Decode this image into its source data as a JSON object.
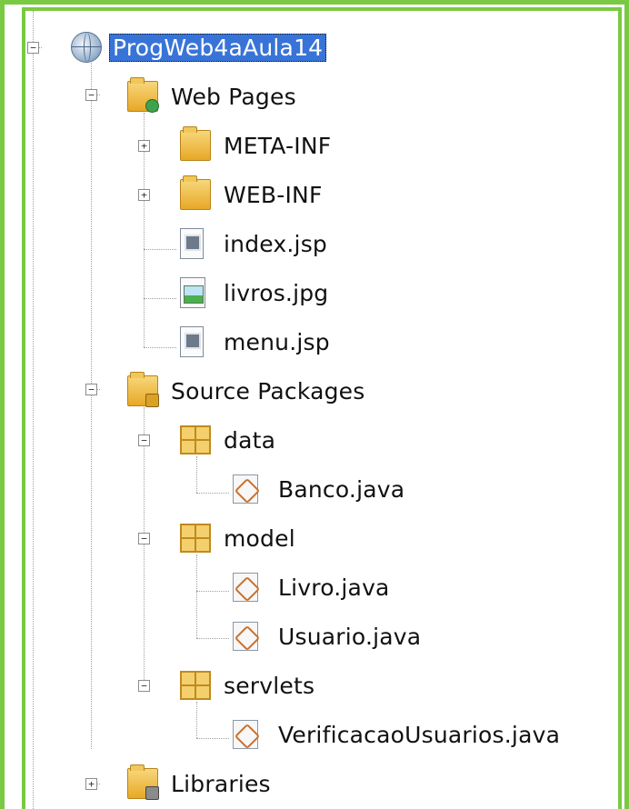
{
  "colors": {
    "frame": "#7ac943",
    "selection": "#3874d8"
  },
  "tree": {
    "project": {
      "label": "ProgWeb4aAula14",
      "icon": "globe-icon",
      "expander": "−"
    },
    "web_pages": {
      "label": "Web Pages",
      "icon": "web-folder-icon",
      "expander": "−"
    },
    "meta_inf": {
      "label": "META-INF",
      "icon": "folder-icon",
      "expander": "+"
    },
    "web_inf": {
      "label": "WEB-INF",
      "icon": "folder-icon",
      "expander": "+"
    },
    "index_jsp": {
      "label": "index.jsp",
      "icon": "jsp-file-icon"
    },
    "livros_jpg": {
      "label": "livros.jpg",
      "icon": "image-file-icon"
    },
    "menu_jsp": {
      "label": "menu.jsp",
      "icon": "jsp-file-icon"
    },
    "source_packages": {
      "label": "Source Packages",
      "icon": "source-folder-icon",
      "expander": "−"
    },
    "pkg_data": {
      "label": "data",
      "icon": "package-icon",
      "expander": "−"
    },
    "banco": {
      "label": "Banco.java",
      "icon": "java-file-icon"
    },
    "pkg_model": {
      "label": "model",
      "icon": "package-icon",
      "expander": "−"
    },
    "livro": {
      "label": "Livro.java",
      "icon": "java-file-icon"
    },
    "usuario": {
      "label": "Usuario.java",
      "icon": "java-file-icon"
    },
    "pkg_servlets": {
      "label": "servlets",
      "icon": "package-icon",
      "expander": "−"
    },
    "verificacao": {
      "label": "VerificacaoUsuarios.java",
      "icon": "java-file-icon"
    },
    "libraries": {
      "label": "Libraries",
      "icon": "library-folder-icon",
      "expander": "+"
    }
  }
}
